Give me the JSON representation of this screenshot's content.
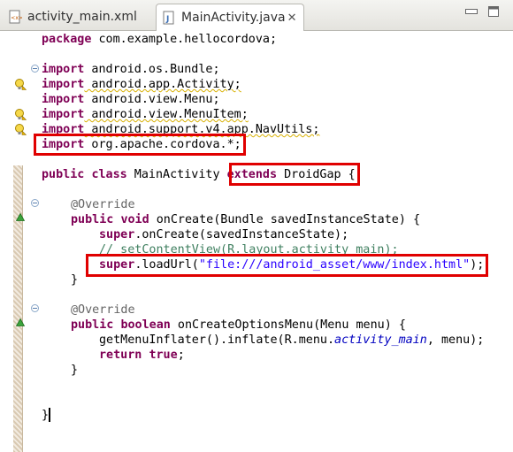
{
  "tabs": [
    {
      "label": "activity_main.xml",
      "active": false
    },
    {
      "label": "MainActivity.java",
      "active": true,
      "close": "✕"
    }
  ],
  "code": {
    "l1": {
      "kw": "package",
      "rest": " com.example.hellocordova;"
    },
    "l3": {
      "kw": "import",
      "rest": " android.os.Bundle;"
    },
    "l4": {
      "kw": "import",
      "rest": " android.app.Activity;"
    },
    "l5": {
      "kw": "import",
      "rest": " android.view.Menu;"
    },
    "l6": {
      "kw": "import",
      "rest": " android.view.MenuItem;"
    },
    "l7": {
      "kw": "import",
      "rest": " android.support.v4.app.NavUtils;"
    },
    "l8": {
      "kw": "import",
      "rest": " org.apache.cordova.*;"
    },
    "l10": {
      "kw1": "public",
      "kw2": "class",
      "name": " MainActivity ",
      "kw3": "extends",
      "rest": " DroidGap {"
    },
    "l12": {
      "ann": "@Override"
    },
    "l13": {
      "kw1": "public",
      "kw2": "void",
      "rest": " onCreate(Bundle savedInstanceState) {"
    },
    "l14": {
      "kw": "super",
      "rest": ".onCreate(savedInstanceState);"
    },
    "l15": {
      "cmt": "// setContentView(R.layout.activity_main);"
    },
    "l16": {
      "kw": "super",
      "pre": ".loadUrl(",
      "str": "\"file:///android_asset/www/index.html\"",
      "post": ");"
    },
    "l17": {
      "rest": "}"
    },
    "l19": {
      "ann": "@Override"
    },
    "l20": {
      "kw1": "public",
      "kw2": "boolean",
      "rest": " onCreateOptionsMenu(Menu menu) {"
    },
    "l21": {
      "pre": "getMenuInflater().inflate(R.menu.",
      "ital": "activity_main",
      "post": ", menu);"
    },
    "l22": {
      "kw1": "return",
      "kw2": "true",
      "rest": ";"
    },
    "l23": {
      "rest": "}"
    },
    "l26": {
      "rest": "}"
    }
  },
  "colors": {
    "keyword": "#7f0055",
    "string": "#2a00ff",
    "comment": "#3f7f5f",
    "annotation": "#646464",
    "field": "#0000c0",
    "highlight_box": "#e00000"
  },
  "icons": {
    "xml_tab": "xml-file-icon",
    "java_tab": "java-file-icon",
    "warning": "warning-lightbulb-icon",
    "override": "override-triangle-icon",
    "fold": "fold-toggle-icon"
  }
}
